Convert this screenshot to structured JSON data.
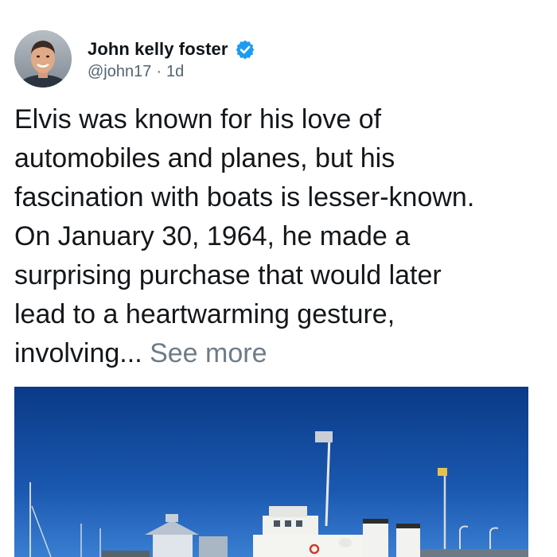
{
  "author": {
    "display_name": "John kelly foster",
    "handle": "@john17",
    "separator": "·",
    "timestamp": "1d",
    "verified": true,
    "avatar_icon": "person-photo"
  },
  "post": {
    "text_lines": [
      "Elvis was known for his love of",
      "automobiles and planes, but his",
      "fascination with boats is lesser-known.",
      "On January 30, 1964, he made a",
      "surprising purchase that would later",
      "lead to a heartwarming gesture,",
      "involving..."
    ],
    "see_more_label": "See more"
  },
  "media": {
    "description_icon": "harbor-yacht-photo"
  },
  "colors": {
    "verified_badge": "#1d9bf0",
    "secondary_text": "#536471",
    "see_more": "#6e7c87",
    "sky_top": "#0a3a86",
    "sky_bottom": "#2e6fc7"
  }
}
